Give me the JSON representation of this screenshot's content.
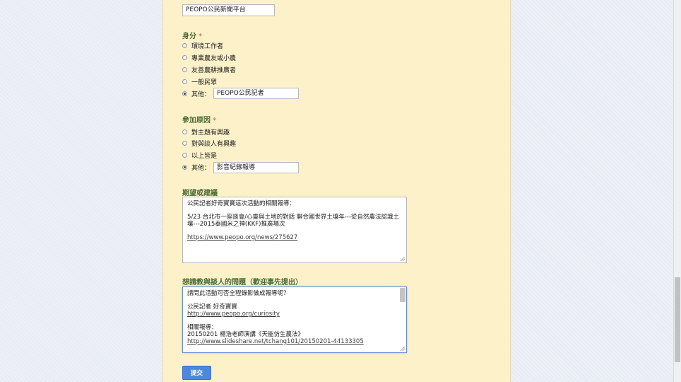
{
  "top_field": {
    "value": "PEOPO公民新聞平台"
  },
  "identity": {
    "title": "身分",
    "required_mark": "*",
    "options": [
      "環境工作者",
      "專業農友或小農",
      "友善農耕推廣者",
      "一般民眾",
      "其他："
    ],
    "other_value": "PEOPO公民記者",
    "selected_index": 4
  },
  "reason": {
    "title": "參加原因",
    "required_mark": "*",
    "options": [
      "對主題有興趣",
      "對與談人有興趣",
      "以上皆是",
      "其他："
    ],
    "other_value": "影音紀錄報導",
    "selected_index": 3
  },
  "expectation": {
    "title": "期望或建議",
    "lines": [
      "公民記者好奇寶寶這次活動的相關報導：",
      "5/23 台北市一座談會/心靈與土地的對話 聯合國世界土壤年---從自然農法認識土壤---2015泰國米之神(KKF)推廣場次",
      "https://www.peopo.org/news/275627"
    ]
  },
  "questions": {
    "title": "想請教與談人的問題（歡迎事先提出）",
    "lines": [
      "請問此活動可否全程錄影做成報導呢？",
      "公民記者 好奇寶寶",
      "http://www.peopo.org/curiosity",
      "相關報導：",
      "20150201 楊浩老師演講《天能仿生農法》",
      "http://www.slideshare.net/tchang101/20150201-44133305"
    ]
  },
  "submit_label": "提交"
}
